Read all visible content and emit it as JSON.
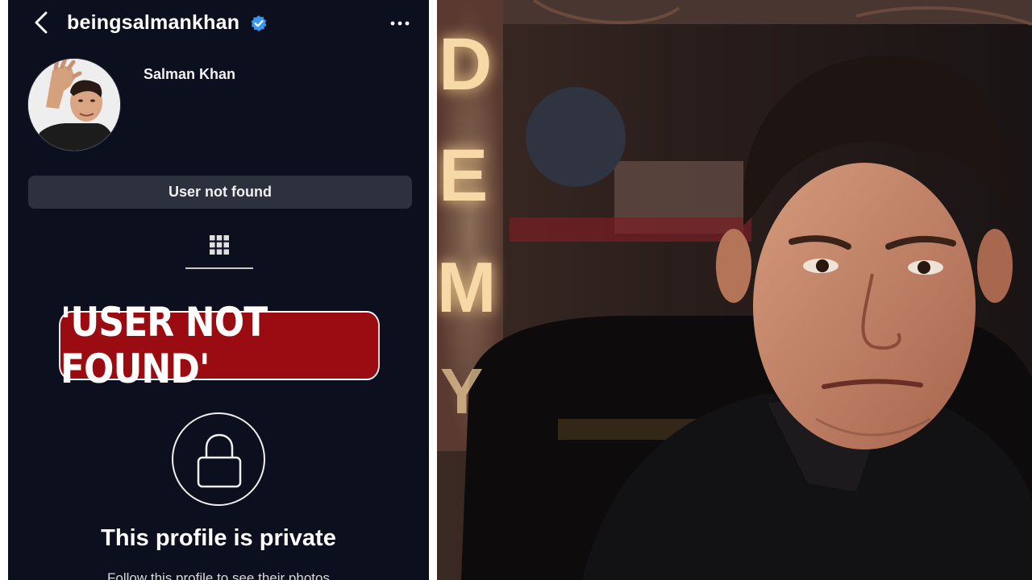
{
  "profile": {
    "username": "beingsalmankhan",
    "display_name": "Salman Khan",
    "status_button": "User not found",
    "banner_text": "'USER NOT FOUND'",
    "private_title": "This profile is private",
    "private_subtitle": "Follow this profile to see their photos"
  },
  "icons": {
    "back": "chevron-left-icon",
    "verified": "verified-badge-icon",
    "more": "more-dots-icon",
    "grid": "grid-icon",
    "lock": "lock-icon"
  },
  "colors": {
    "phone_bg": "#0c0f1e",
    "button_bg": "#2d313d",
    "verified": "#3897f0",
    "banner": "#9a0c12"
  },
  "photo": {
    "sign_letters": [
      "D",
      "E",
      "M",
      "Y"
    ]
  }
}
